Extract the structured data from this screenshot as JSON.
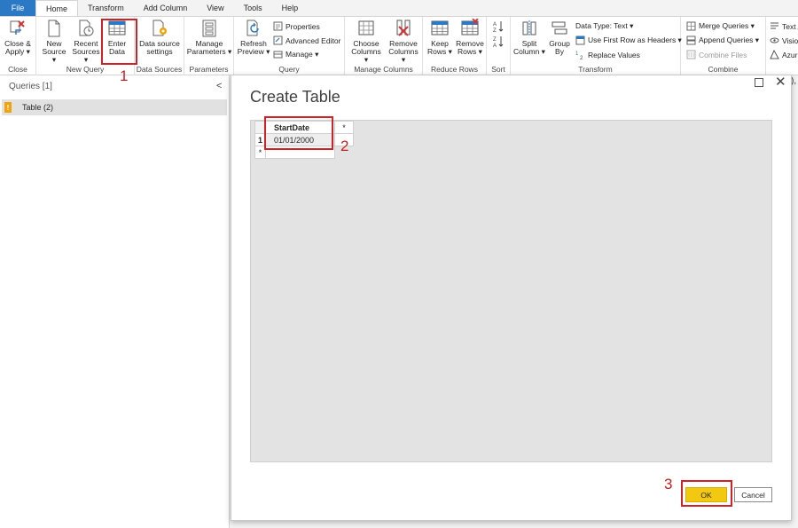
{
  "tabs": [
    "File",
    "Home",
    "Transform",
    "Add Column",
    "View",
    "Tools",
    "Help"
  ],
  "ribbon": {
    "close_group": {
      "label": "Close",
      "close_apply": [
        "Close &",
        "Apply ▾"
      ]
    },
    "new_query_group": {
      "label": "New Query",
      "new_source": [
        "New",
        "Source ▾"
      ],
      "recent_sources": [
        "Recent",
        "Sources ▾"
      ],
      "enter_data": [
        "Enter",
        "Data"
      ]
    },
    "data_sources_group": {
      "label": "Data Sources",
      "data_source_settings": [
        "Data source",
        "settings"
      ]
    },
    "parameters_group": {
      "label": "Parameters",
      "manage_parameters": [
        "Manage",
        "Parameters ▾"
      ]
    },
    "query_group": {
      "label": "Query",
      "refresh_preview": [
        "Refresh",
        "Preview ▾"
      ],
      "properties": "Properties",
      "advanced_editor": "Advanced Editor",
      "manage": "Manage ▾"
    },
    "manage_columns_group": {
      "label": "Manage Columns",
      "choose_columns": [
        "Choose",
        "Columns ▾"
      ],
      "remove_columns": [
        "Remove",
        "Columns ▾"
      ]
    },
    "reduce_rows_group": {
      "label": "Reduce Rows",
      "keep_rows": [
        "Keep",
        "Rows ▾"
      ],
      "remove_rows": [
        "Remove",
        "Rows ▾"
      ]
    },
    "sort_group": {
      "label": "Sort"
    },
    "transform_group": {
      "label": "Transform",
      "split_column": [
        "Split",
        "Column ▾"
      ],
      "group_by": [
        "Group",
        "By"
      ],
      "data_type": "Data Type: Text ▾",
      "first_row_headers": "Use First Row as Headers ▾",
      "replace_values": "Replace Values"
    },
    "combine_group": {
      "label": "Combine",
      "merge_queries": "Merge Queries ▾",
      "append_queries": "Append Queries ▾",
      "combine_files": "Combine Files"
    },
    "ai_group": {
      "text": "Text A",
      "vision": "Visio",
      "azure": "Azur"
    }
  },
  "queries_pane": {
    "header": "Queries [1]",
    "collapse": "<",
    "items": [
      {
        "label": "Table (2)",
        "warning": "!"
      }
    ]
  },
  "dialog": {
    "title": "Create Table",
    "column_header": "StartDate",
    "add_column": "*",
    "row_number": "1",
    "cell_value": "01/01/2000",
    "add_row": "*",
    "ok": "OK",
    "cancel": "Cancel"
  },
  "annotations": {
    "step1": "1",
    "step2": "2",
    "step3": "3"
  },
  "edge_glimpse": "),"
}
